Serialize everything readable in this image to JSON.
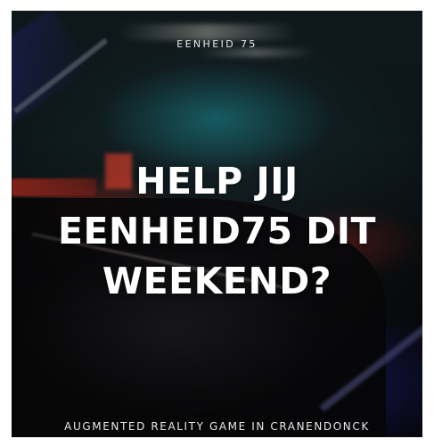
{
  "poster": {
    "kicker": "EENHEID 75",
    "headline_lines": [
      "HELP JIJ",
      "EENHEID75 DIT",
      "WEEKEND?"
    ],
    "footer": "AUGMENTED REALITY GAME IN CRANENDONCK"
  },
  "colors": {
    "text": "#ffffff",
    "accent_red": "#e63c28",
    "accent_blue": "#3c3cc8",
    "accent_teal": "#1e8c96",
    "background": "#0b0d10"
  }
}
